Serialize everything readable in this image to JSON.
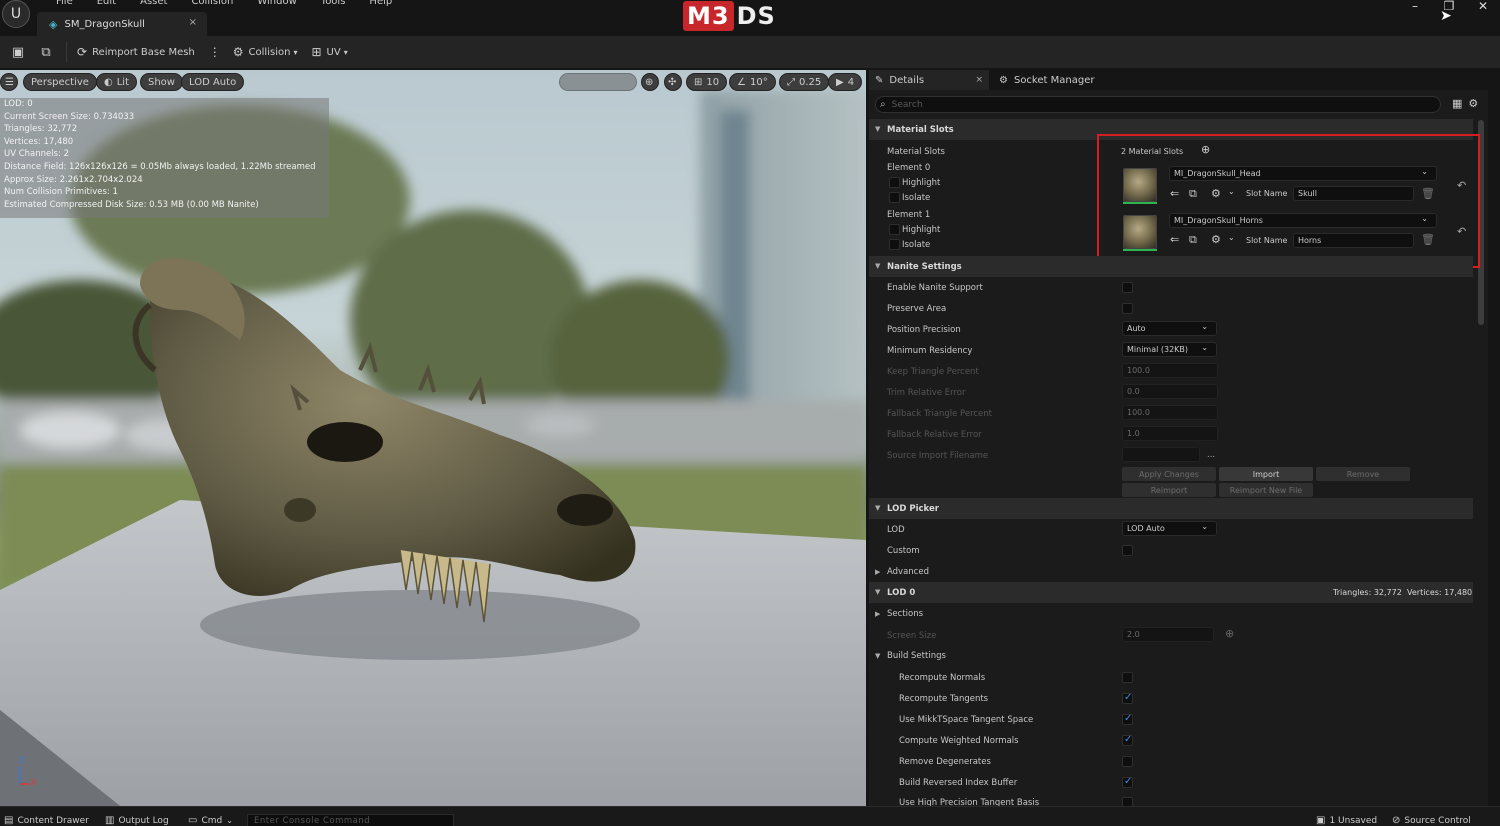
{
  "menu": {
    "items": [
      "File",
      "Edit",
      "Asset",
      "Collision",
      "Window",
      "Tools",
      "Help"
    ]
  },
  "asset_tab": {
    "title": "SM_DragonSkull",
    "close": "×"
  },
  "brand": {
    "logo_red": "M3",
    "logo_white": "DS"
  },
  "window_controls": {
    "minimize": "–",
    "restore": "❐",
    "close": "✕"
  },
  "toolbar": {
    "reimport": "Reimport Base Mesh",
    "collision": "Collision",
    "uv": "UV"
  },
  "viewport": {
    "perspective": "Perspective",
    "lit": "Lit",
    "show": "Show",
    "lod": "LOD Auto",
    "grid_value": "10",
    "angle_value": "10°",
    "scale_value": "0.25",
    "camera_value": "4",
    "stats": [
      "LOD: 0",
      "Current Screen Size: 0.734033",
      "Triangles: 32,772",
      "Vertices: 17,480",
      "UV Channels: 2",
      "Distance Field: 126x126x126 = 0.05Mb always loaded, 1.22Mb streamed",
      "Approx Size: 2.261x2.704x2.024",
      "Num Collision Primitives: 1",
      "Estimated Compressed Disk Size: 0.53 MB (0.00 MB Nanite)"
    ],
    "axis_z": "Z",
    "axis_x": "X"
  },
  "details": {
    "tab_details": "Details",
    "tab_close": "×",
    "tab_socket": "Socket Manager",
    "search_placeholder": "Search",
    "material_slots": {
      "header": "Material Slots",
      "label": "Material Slots",
      "count": "2 Material Slots",
      "element0": "Element 0",
      "element1": "Element 1",
      "highlight": "Highlight",
      "isolate": "Isolate",
      "mat0": "MI_DragonSkull_Head",
      "mat1": "MI_DragonSkull_Horns",
      "slot_name_label": "Slot Name",
      "slot0": "Skull",
      "slot1": "Horns"
    },
    "nanite": {
      "header": "Nanite Settings",
      "enable": "Enable Nanite Support",
      "preserve": "Preserve Area",
      "position_precision": "Position Precision",
      "position_precision_value": "Auto",
      "min_residency": "Minimum Residency",
      "min_residency_value": "Minimal (32KB)",
      "keep_triangle": "Keep Triangle Percent",
      "keep_triangle_value": "100.0",
      "trim_error": "Trim Relative Error",
      "trim_error_value": "0.0",
      "fallback_triangle": "Fallback Triangle Percent",
      "fallback_triangle_value": "100.0",
      "fallback_error": "Fallback Relative Error",
      "fallback_error_value": "1.0",
      "source_import": "Source Import Filename",
      "ellipsis": "...",
      "apply": "Apply Changes",
      "import": "Import",
      "remove": "Remove",
      "reimport": "Reimport",
      "reimport_new": "Reimport New File"
    },
    "lod_picker": {
      "header": "LOD Picker",
      "lod": "LOD",
      "lod_value": "LOD Auto",
      "custom": "Custom",
      "advanced": "Advanced"
    },
    "lod0": {
      "header": "LOD 0",
      "triangles": "Triangles: 32,772",
      "vertices": "Vertices: 17,480",
      "sections": "Sections",
      "screen_size": "Screen Size",
      "screen_size_value": "2.0",
      "build_settings": "Build Settings",
      "recompute_normals": "Recompute Normals",
      "recompute_tangents": "Recompute Tangents",
      "mikkt": "Use MikkTSpace Tangent Space",
      "weighted": "Compute Weighted Normals",
      "degenerates": "Remove Degenerates",
      "reversed": "Build Reversed Index Buffer",
      "high_precision": "Use High Precision Tangent Basis"
    }
  },
  "statusbar": {
    "content_drawer": "Content Drawer",
    "output_log": "Output Log",
    "cmd": "Cmd",
    "console_placeholder": "Enter Console Command",
    "unsaved": "1 Unsaved",
    "source_control": "Source Control"
  },
  "colors": {
    "accent_red": "#d61d22",
    "check_blue": "#3b8ae5",
    "background": "#151515"
  }
}
